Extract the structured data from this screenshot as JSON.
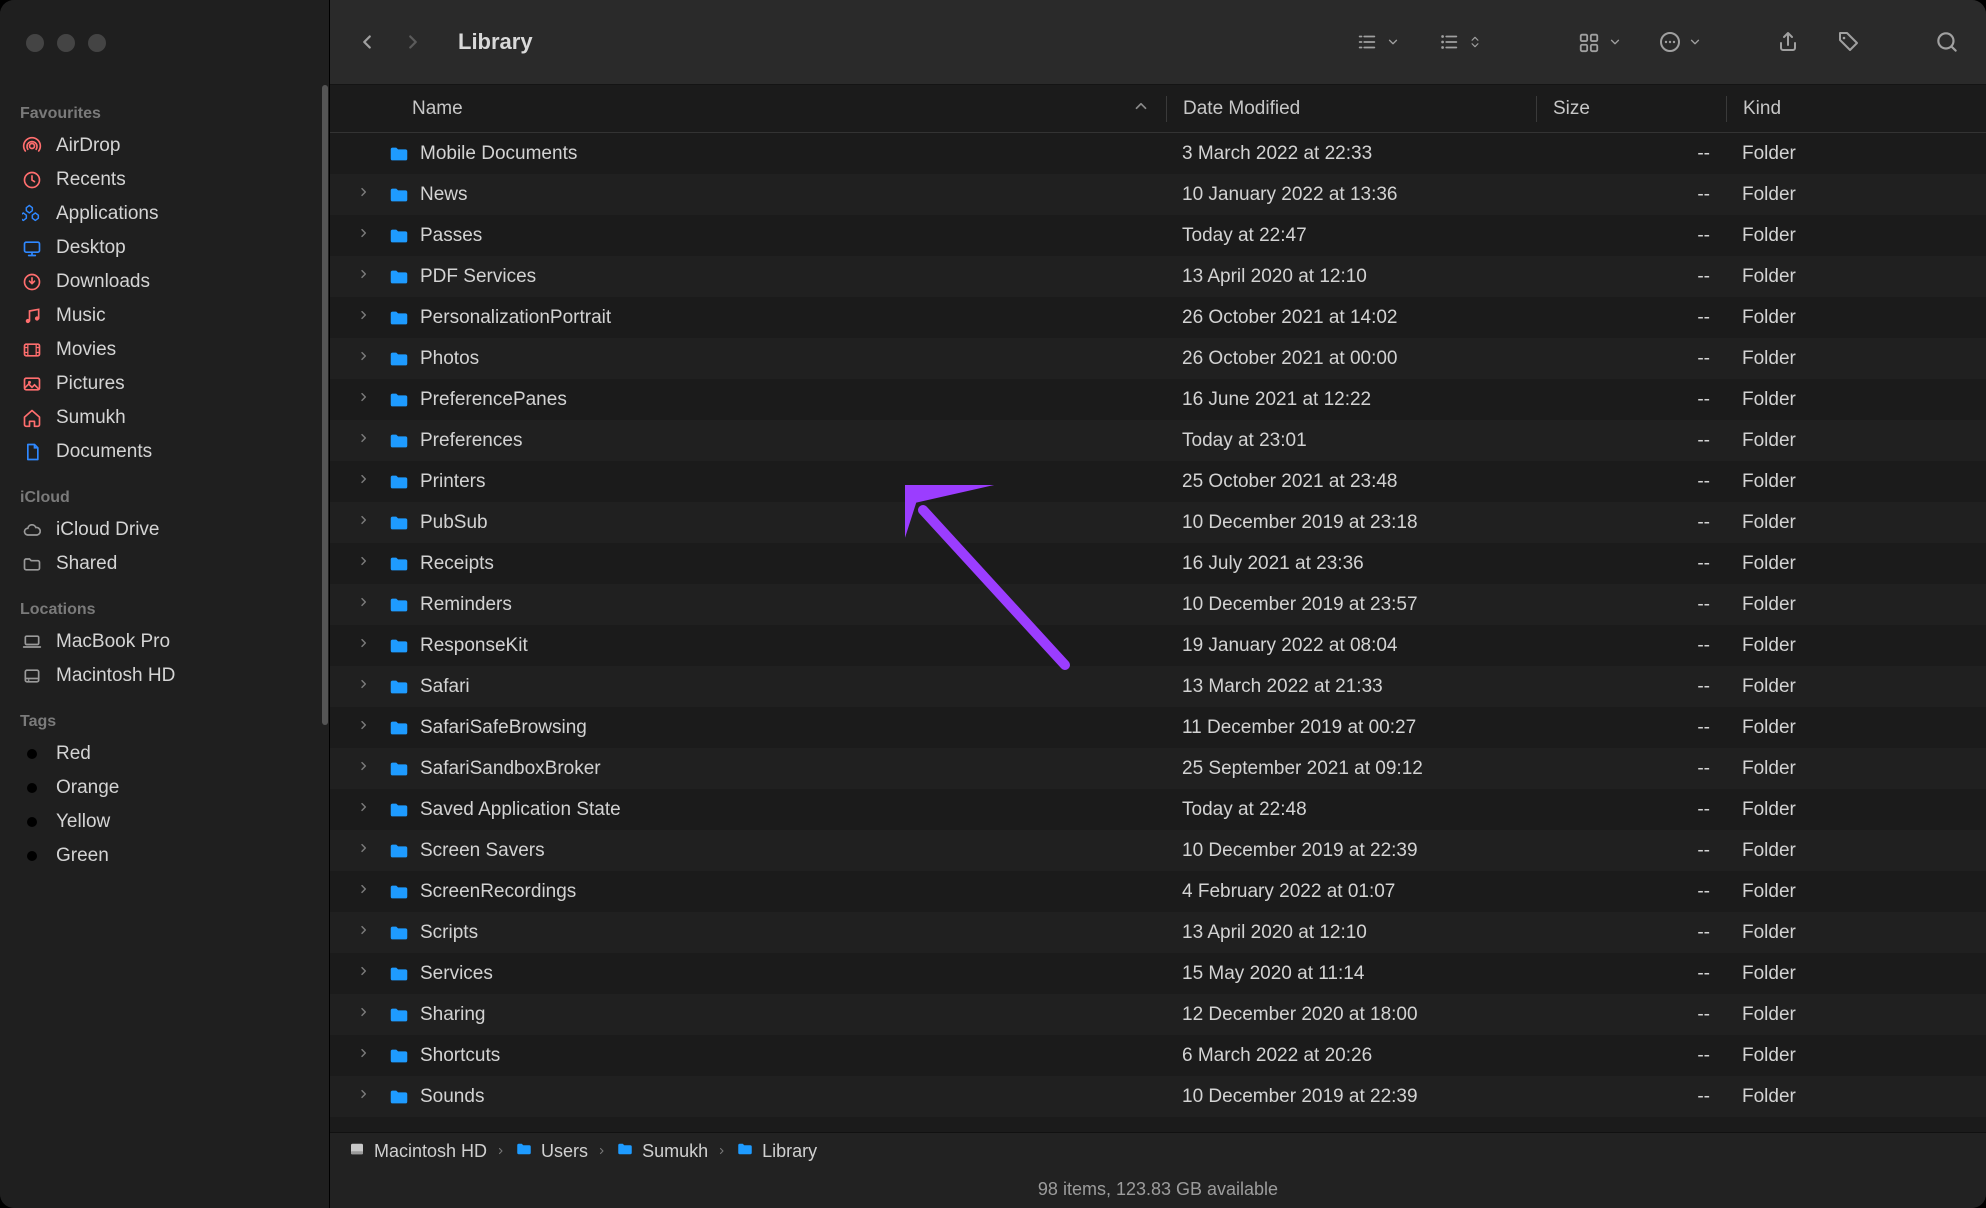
{
  "window": {
    "title": "Library"
  },
  "sidebar": {
    "sections": [
      {
        "title": "Favourites",
        "items": [
          {
            "icon": "airdrop",
            "label": "AirDrop"
          },
          {
            "icon": "clock",
            "label": "Recents"
          },
          {
            "icon": "app",
            "label": "Applications"
          },
          {
            "icon": "desktop",
            "label": "Desktop"
          },
          {
            "icon": "download",
            "label": "Downloads"
          },
          {
            "icon": "music",
            "label": "Music"
          },
          {
            "icon": "movie",
            "label": "Movies"
          },
          {
            "icon": "picture",
            "label": "Pictures"
          },
          {
            "icon": "home",
            "label": "Sumukh"
          },
          {
            "icon": "document",
            "label": "Documents"
          }
        ]
      },
      {
        "title": "iCloud",
        "items": [
          {
            "icon": "cloud",
            "label": "iCloud Drive"
          },
          {
            "icon": "shared",
            "label": "Shared"
          }
        ]
      },
      {
        "title": "Locations",
        "items": [
          {
            "icon": "laptop",
            "label": "MacBook Pro"
          },
          {
            "icon": "disk",
            "label": "Macintosh HD"
          }
        ]
      },
      {
        "title": "Tags",
        "items": [
          {
            "icon": "tag",
            "label": "Red",
            "color": "#ff5f57"
          },
          {
            "icon": "tag",
            "label": "Orange",
            "color": "#ff9f0a"
          },
          {
            "icon": "tag",
            "label": "Yellow",
            "color": "#ffd60a"
          },
          {
            "icon": "tag",
            "label": "Green",
            "color": "#30d158"
          }
        ]
      }
    ]
  },
  "columns": {
    "name": "Name",
    "date": "Date Modified",
    "size": "Size",
    "kind": "Kind"
  },
  "rows": [
    {
      "expandable": false,
      "name": "Mobile Documents",
      "date": "3 March 2022 at 22:33",
      "size": "--",
      "kind": "Folder"
    },
    {
      "expandable": true,
      "name": "News",
      "date": "10 January 2022 at 13:36",
      "size": "--",
      "kind": "Folder"
    },
    {
      "expandable": true,
      "name": "Passes",
      "date": "Today at 22:47",
      "size": "--",
      "kind": "Folder"
    },
    {
      "expandable": true,
      "name": "PDF Services",
      "date": "13 April 2020 at 12:10",
      "size": "--",
      "kind": "Folder"
    },
    {
      "expandable": true,
      "name": "PersonalizationPortrait",
      "date": "26 October 2021 at 14:02",
      "size": "--",
      "kind": "Folder"
    },
    {
      "expandable": true,
      "name": "Photos",
      "date": "26 October 2021 at 00:00",
      "size": "--",
      "kind": "Folder"
    },
    {
      "expandable": true,
      "name": "PreferencePanes",
      "date": "16 June 2021 at 12:22",
      "size": "--",
      "kind": "Folder"
    },
    {
      "expandable": true,
      "name": "Preferences",
      "date": "Today at 23:01",
      "size": "--",
      "kind": "Folder"
    },
    {
      "expandable": true,
      "name": "Printers",
      "date": "25 October 2021 at 23:48",
      "size": "--",
      "kind": "Folder"
    },
    {
      "expandable": true,
      "name": "PubSub",
      "date": "10 December 2019 at 23:18",
      "size": "--",
      "kind": "Folder"
    },
    {
      "expandable": true,
      "name": "Receipts",
      "date": "16 July 2021 at 23:36",
      "size": "--",
      "kind": "Folder"
    },
    {
      "expandable": true,
      "name": "Reminders",
      "date": "10 December 2019 at 23:57",
      "size": "--",
      "kind": "Folder"
    },
    {
      "expandable": true,
      "name": "ResponseKit",
      "date": "19 January 2022 at 08:04",
      "size": "--",
      "kind": "Folder"
    },
    {
      "expandable": true,
      "name": "Safari",
      "date": "13 March 2022 at 21:33",
      "size": "--",
      "kind": "Folder"
    },
    {
      "expandable": true,
      "name": "SafariSafeBrowsing",
      "date": "11 December 2019 at 00:27",
      "size": "--",
      "kind": "Folder"
    },
    {
      "expandable": true,
      "name": "SafariSandboxBroker",
      "date": "25 September 2021 at 09:12",
      "size": "--",
      "kind": "Folder"
    },
    {
      "expandable": true,
      "name": "Saved Application State",
      "date": "Today at 22:48",
      "size": "--",
      "kind": "Folder"
    },
    {
      "expandable": true,
      "name": "Screen Savers",
      "date": "10 December 2019 at 22:39",
      "size": "--",
      "kind": "Folder"
    },
    {
      "expandable": true,
      "name": "ScreenRecordings",
      "date": "4 February 2022 at 01:07",
      "size": "--",
      "kind": "Folder"
    },
    {
      "expandable": true,
      "name": "Scripts",
      "date": "13 April 2020 at 12:10",
      "size": "--",
      "kind": "Folder"
    },
    {
      "expandable": true,
      "name": "Services",
      "date": "15 May 2020 at 11:14",
      "size": "--",
      "kind": "Folder"
    },
    {
      "expandable": true,
      "name": "Sharing",
      "date": "12 December 2020 at 18:00",
      "size": "--",
      "kind": "Folder"
    },
    {
      "expandable": true,
      "name": "Shortcuts",
      "date": "6 March 2022 at 20:26",
      "size": "--",
      "kind": "Folder"
    },
    {
      "expandable": true,
      "name": "Sounds",
      "date": "10 December 2019 at 22:39",
      "size": "--",
      "kind": "Folder"
    }
  ],
  "path": [
    {
      "icon": "disk",
      "label": "Macintosh HD"
    },
    {
      "icon": "folder",
      "label": "Users"
    },
    {
      "icon": "folder",
      "label": "Sumukh"
    },
    {
      "icon": "folder",
      "label": "Library"
    }
  ],
  "status": "98 items, 123.83 GB available",
  "arrow_target_row_index": 7
}
